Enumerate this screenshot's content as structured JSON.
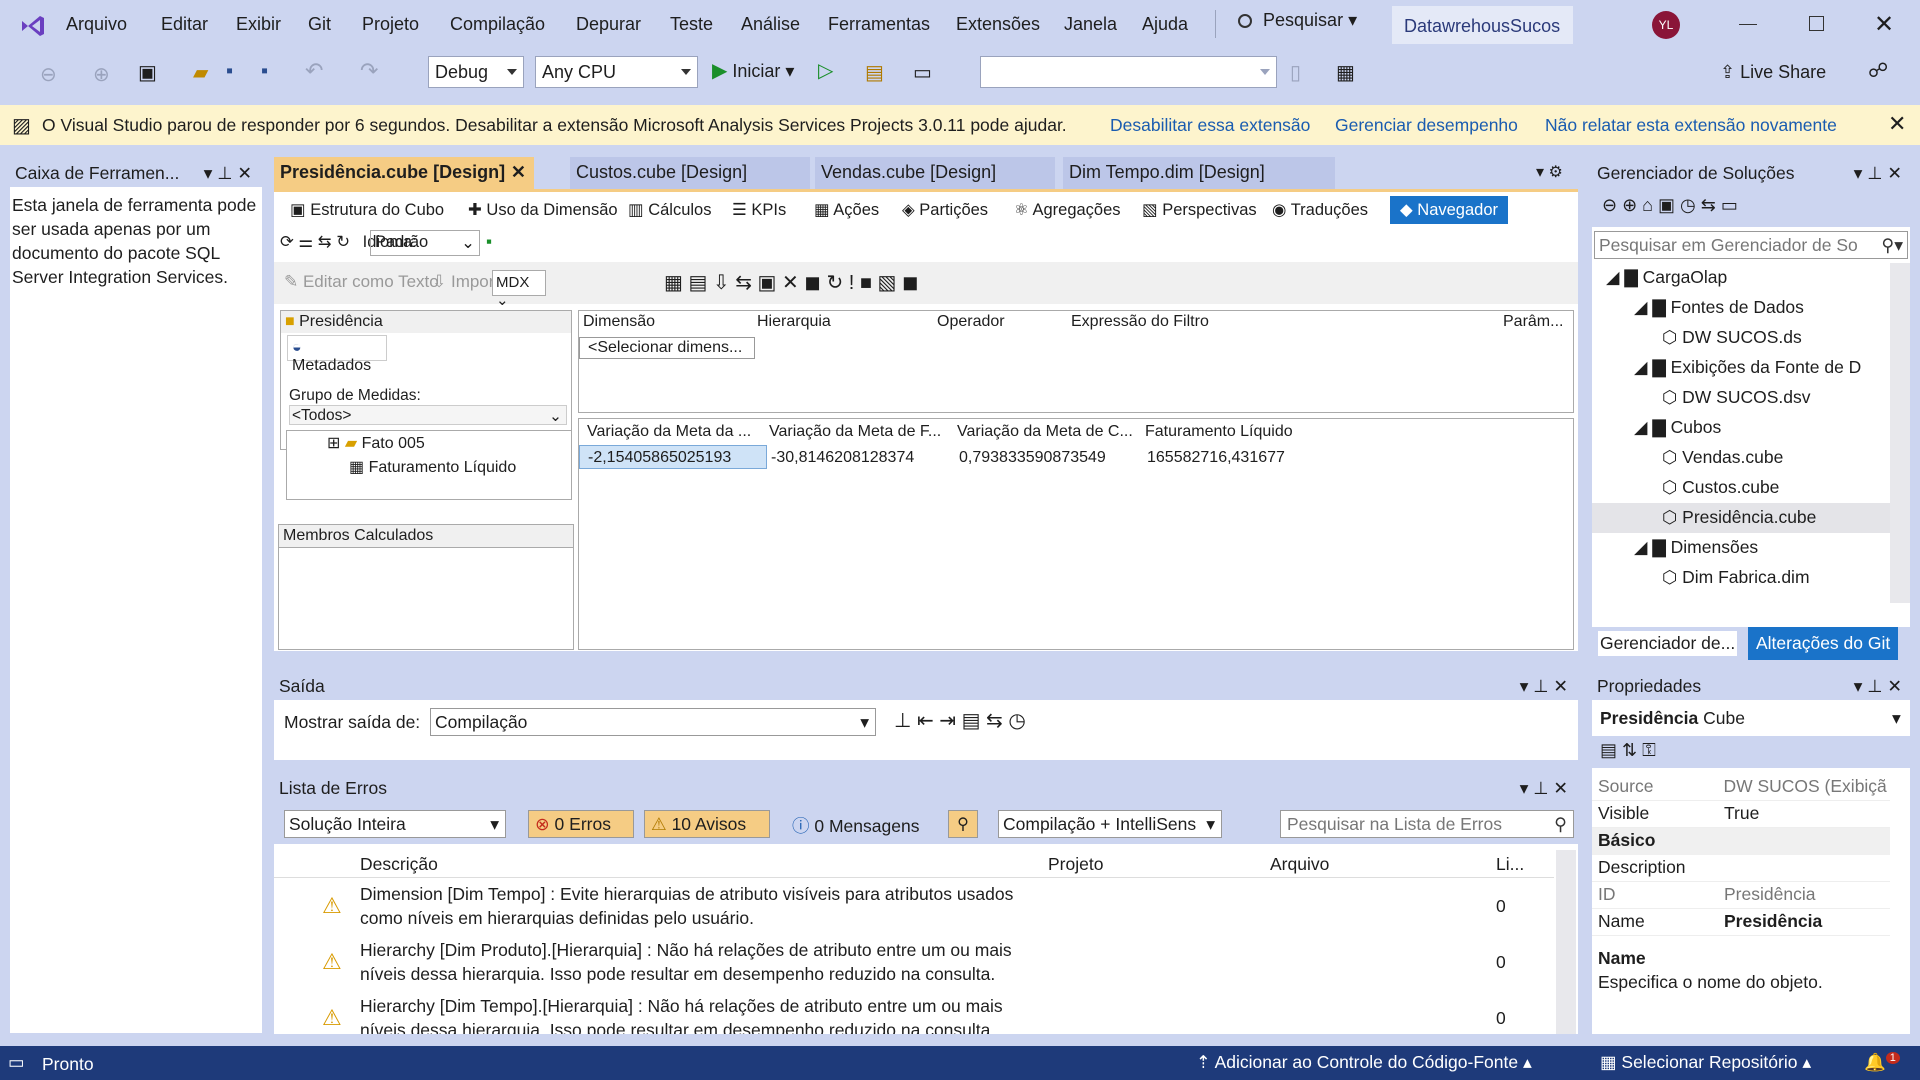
{
  "menu": {
    "items": [
      "Arquivo",
      "Editar",
      "Exibir",
      "Git",
      "Projeto",
      "Compilação",
      "Depurar",
      "Teste",
      "Análise",
      "Ferramentas",
      "Extensões",
      "Janela",
      "Ajuda"
    ],
    "search": "Pesquisar",
    "project_name": "DatawrehousSucos",
    "avatar": "YL"
  },
  "toolbar": {
    "config": "Debug",
    "platform": "Any CPU",
    "start": "Iniciar",
    "live_share": "Live Share"
  },
  "infobar": {
    "message": "O Visual Studio parou de responder por 6 segundos. Desabilitar a extensão Microsoft Analysis Services Projects 3.0.11 pode ajudar.",
    "link1": "Desabilitar essa extensão",
    "link2": "Gerenciar desempenho",
    "link3": "Não relatar esta extensão novamente"
  },
  "toolbox": {
    "title": "Caixa de Ferramen...",
    "text": "Esta janela de ferramenta pode ser usada apenas por um documento do pacote SQL Server Integration Services."
  },
  "doc_tabs": [
    "Presidência.cube [Design]",
    "Custos.cube [Design]",
    "Vendas.cube [Design]",
    "Dim Tempo.dim [Design]"
  ],
  "cube_tabs": [
    "Estrutura do Cubo",
    "Uso da Dimensão",
    "Cálculos",
    "KPIs",
    "Ações",
    "Partições",
    "Agregações",
    "Perspectivas",
    "Traduções",
    "Navegador"
  ],
  "browser": {
    "idioma_label": "Idioma:",
    "idioma_value": "Padrão",
    "edit_text": "Editar como Texto",
    "import": "Importar...",
    "mdx": "MDX",
    "cube_name": "Presidência",
    "metadata": "Metadados",
    "measure_group_label": "Grupo de Medidas:",
    "measure_group_value": "<Todos>",
    "tree": [
      "Fato 005",
      "Faturamento Líquido"
    ],
    "calc_members": "Membros Calculados",
    "filter_headers": [
      "Dimensão",
      "Hierarquia",
      "Operador",
      "Expressão do Filtro",
      "Parâm..."
    ],
    "filter_placeholder": "<Selecionar dimens...",
    "result_headers": [
      "Variação da Meta da ...",
      "Variação da Meta de F...",
      "Variação da Meta de C...",
      "Faturamento Líquido"
    ],
    "result_values": [
      "-2,15405865025193",
      "-30,8146208128374",
      "0,793833590873549",
      "165582716,431677"
    ]
  },
  "output": {
    "title": "Saída",
    "show_label": "Mostrar saída de:",
    "show_value": "Compilação"
  },
  "errors": {
    "title": "Lista de Erros",
    "scope": "Solução Inteira",
    "errors": "0 Erros",
    "warnings": "10 Avisos",
    "messages": "0 Mensagens",
    "build": "Compilação + IntelliSens",
    "search": "Pesquisar na Lista de Erros",
    "headers": [
      "Descrição",
      "Projeto",
      "Arquivo",
      "Li..."
    ],
    "rows": [
      {
        "l1": "Dimension [Dim Tempo] : Evite hierarquias de atributo visíveis para atributos usados",
        "l2": "como níveis em hierarquias definidas pelo usuário.",
        "line": "0"
      },
      {
        "l1": "Hierarchy [Dim Produto].[Hierarquia] : Não há relações de atributo entre um ou mais",
        "l2": "níveis dessa hierarquia. Isso pode resultar em desempenho reduzido na consulta.",
        "line": "0"
      },
      {
        "l1": "Hierarchy [Dim Tempo].[Hierarquia] : Não há relações de atributo entre um ou mais",
        "l2": "níveis dessa hierarquia. Isso pode resultar em desempenho reduzido na consulta.",
        "line": "0"
      }
    ]
  },
  "solution": {
    "title": "Gerenciador de Soluções",
    "search": "Pesquisar em Gerenciador de So",
    "items": [
      {
        "t": "CargaOlap",
        "lvl": 0
      },
      {
        "t": "Fontes de Dados",
        "lvl": 1
      },
      {
        "t": "DW SUCOS.ds",
        "lvl": 2
      },
      {
        "t": "Exibições da Fonte de D",
        "lvl": 1
      },
      {
        "t": "DW SUCOS.dsv",
        "lvl": 2
      },
      {
        "t": "Cubos",
        "lvl": 1
      },
      {
        "t": "Vendas.cube",
        "lvl": 2
      },
      {
        "t": "Custos.cube",
        "lvl": 2
      },
      {
        "t": "Presidência.cube",
        "lvl": 2
      },
      {
        "t": "Dimensões",
        "lvl": 1
      },
      {
        "t": "Dim Fabrica.dim",
        "lvl": 2
      }
    ],
    "tab1": "Gerenciador de...",
    "tab2": "Alterações do Git"
  },
  "properties": {
    "title": "Propriedades",
    "object": "Presidência",
    "type": "Cube",
    "rows": [
      {
        "k": "Source",
        "v": "DW SUCOS (Exibiçã"
      },
      {
        "k": "Visible",
        "v": "True"
      }
    ],
    "category": "Básico",
    "rows2": [
      {
        "k": "Description",
        "v": ""
      },
      {
        "k": "ID",
        "v": "Presidência"
      },
      {
        "k": "Name",
        "v": "Presidência"
      }
    ],
    "desc_title": "Name",
    "desc_text": "Especifica o nome do objeto."
  },
  "status": {
    "ready": "Pronto",
    "source_control": "Adicionar ao Controle do Código-Fonte",
    "repo": "Selecionar Repositório",
    "notif": "1"
  }
}
